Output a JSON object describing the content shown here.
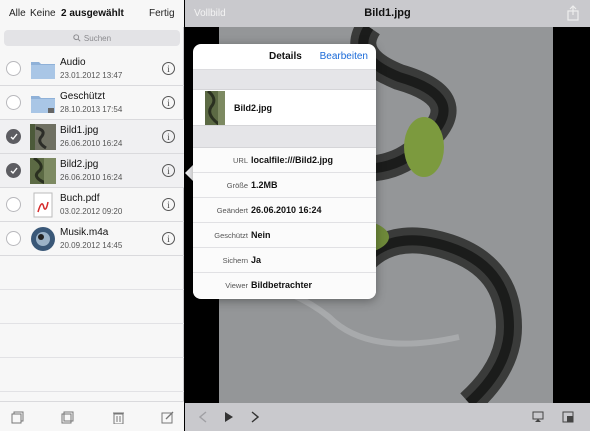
{
  "sidebar": {
    "toolbar": {
      "all": "Alle",
      "none": "Keine",
      "title": "2 ausgewählt",
      "done": "Fertig"
    },
    "search": {
      "placeholder": "Suchen"
    },
    "items": [
      {
        "name": "Audio",
        "date": "23.01.2012 13:47",
        "type": "folder",
        "selected": false
      },
      {
        "name": "Geschützt",
        "date": "28.10.2013 17:54",
        "type": "locked-folder",
        "selected": false
      },
      {
        "name": "Bild1.jpg",
        "date": "26.06.2010 16:24",
        "type": "image",
        "selected": true
      },
      {
        "name": "Bild2.jpg",
        "date": "26.06.2010 16:24",
        "type": "image",
        "selected": true
      },
      {
        "name": "Buch.pdf",
        "date": "03.02.2012 09:20",
        "type": "pdf",
        "selected": false
      },
      {
        "name": "Musik.m4a",
        "date": "20.09.2012 14:45",
        "type": "audio",
        "selected": false
      }
    ],
    "bottom_icons": [
      "copy-icon",
      "move-icon",
      "trash-icon",
      "compose-icon"
    ]
  },
  "viewer": {
    "fullscreen": "Vollbild",
    "title": "Bild1.jpg",
    "bottom_icons": [
      "previous-icon",
      "play-icon",
      "next-icon",
      "airplay-icon",
      "window-icon"
    ]
  },
  "popover": {
    "title": "Details",
    "edit": "Bearbeiten",
    "file_name": "Bild2.jpg",
    "rows": [
      {
        "label": "URL",
        "value": "localfile:///Bild2.jpg"
      },
      {
        "label": "Größe",
        "value": "1.2MB"
      },
      {
        "label": "Geändert",
        "value": "26.06.2010 16:24"
      },
      {
        "label": "Geschützt",
        "value": "Nein"
      },
      {
        "label": "Sichern",
        "value": "Ja"
      },
      {
        "label": "Viewer",
        "value": "Bildbetrachter"
      }
    ]
  },
  "colors": {
    "accent": "#1a6ad8",
    "toolbar": "#c9c9cd",
    "sidebar": "#f7f7f7"
  }
}
